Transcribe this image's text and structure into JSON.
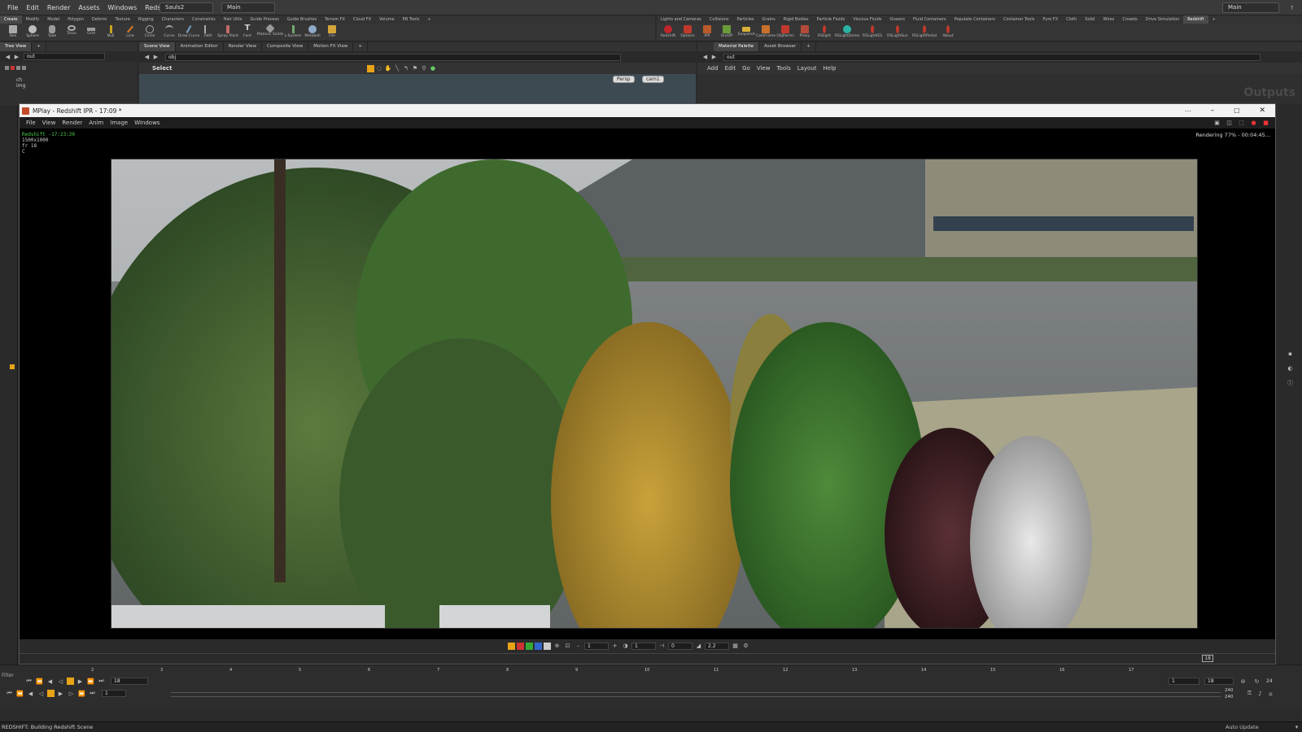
{
  "menubar": {
    "items": [
      "File",
      "Edit",
      "Render",
      "Assets",
      "Windows",
      "Redshift",
      "Help"
    ],
    "desktop": "Sauls2",
    "context": "Main",
    "right_desktop": "Main"
  },
  "shelf_tabs_left": [
    "Create",
    "Modify",
    "Model",
    "Polygon",
    "Deform",
    "Texture",
    "Rigging",
    "Characters",
    "Constraints",
    "Hair Utils",
    "Guide Process",
    "Guide Brushes",
    "Terrain FX",
    "Cloud FX",
    "Volume",
    "EB Tools"
  ],
  "shelf_tabs_right": [
    "Lights and Cameras",
    "Collisions",
    "Particles",
    "Grains",
    "Rigid Bodies",
    "Particle Fluids",
    "Viscous Fluids",
    "Oceans",
    "Fluid Containers",
    "Populate Containers",
    "Container Tools",
    "Pyro FX",
    "Cloth",
    "Solid",
    "Wires",
    "Crowds",
    "Drive Simulation",
    "Redshift"
  ],
  "tools_left": [
    "Box",
    "Sphere",
    "Tube",
    "Torus",
    "Grid",
    "Null",
    "Line",
    "Circle",
    "Curve",
    "Draw Curve",
    "Path",
    "Spray Paint",
    "Font",
    "Platonic Solids",
    "L-System",
    "Metaball",
    "File"
  ],
  "tools_right": [
    "Redshift",
    "Options",
    "IPR",
    "On/Off",
    "Snapshot",
    "CamFrame",
    "ObjParms",
    "Proxy",
    "RSlight",
    "RSLightDome",
    "RSLightIES",
    "RSLightSun",
    "RSLightPortal",
    "About"
  ],
  "left_pane": {
    "tab": "Tree View",
    "path": "out",
    "items": [
      "ch",
      "img"
    ]
  },
  "center_pane": {
    "tabs": [
      "Scene View",
      "Animation Editor",
      "Render View",
      "Composite View",
      "Motion FX View"
    ],
    "path": "obj",
    "tool": "Select",
    "persp": "Persp",
    "cam": "cam1"
  },
  "right_pane": {
    "tabs": [
      "Material Palette",
      "Asset Browser"
    ],
    "path": "out",
    "menu": [
      "Add",
      "Edit",
      "Go",
      "View",
      "Tools",
      "Layout",
      "Help"
    ],
    "watermark": "Outputs"
  },
  "mplay": {
    "title": "MPlay - Redshift IPR - 17:09 *",
    "menu": [
      "File",
      "View",
      "Render",
      "Anim",
      "Image",
      "Windows"
    ],
    "info_line1": "Redshift -17:23:20",
    "info_line2": "1500x1000",
    "info_line3": "fr 18",
    "info_line4": "C",
    "status": "Rendering 77% - 00:04:45...",
    "field_a": "1",
    "field_b": "1",
    "field_c": "0",
    "gamma": "2.2",
    "frame_box": "18"
  },
  "timeline": {
    "ticks": [
      "2",
      "3",
      "4",
      "5",
      "6",
      "7",
      "8",
      "9",
      "10",
      "11",
      "12",
      "13",
      "14",
      "15",
      "16",
      "17"
    ],
    "current_frame": "18",
    "start": "1",
    "start2": "1",
    "end_a": "18",
    "fps": "24",
    "range_end": "240",
    "range_end2": "240",
    "filter_label": "Filter"
  },
  "status": {
    "message": "REDSHIFT: Building Redshift Scene",
    "auto_update": "Auto Update"
  },
  "colors": {
    "accent": "#e8a317",
    "panel": "#2f2f2f",
    "menubar": "#3a3a3a"
  }
}
